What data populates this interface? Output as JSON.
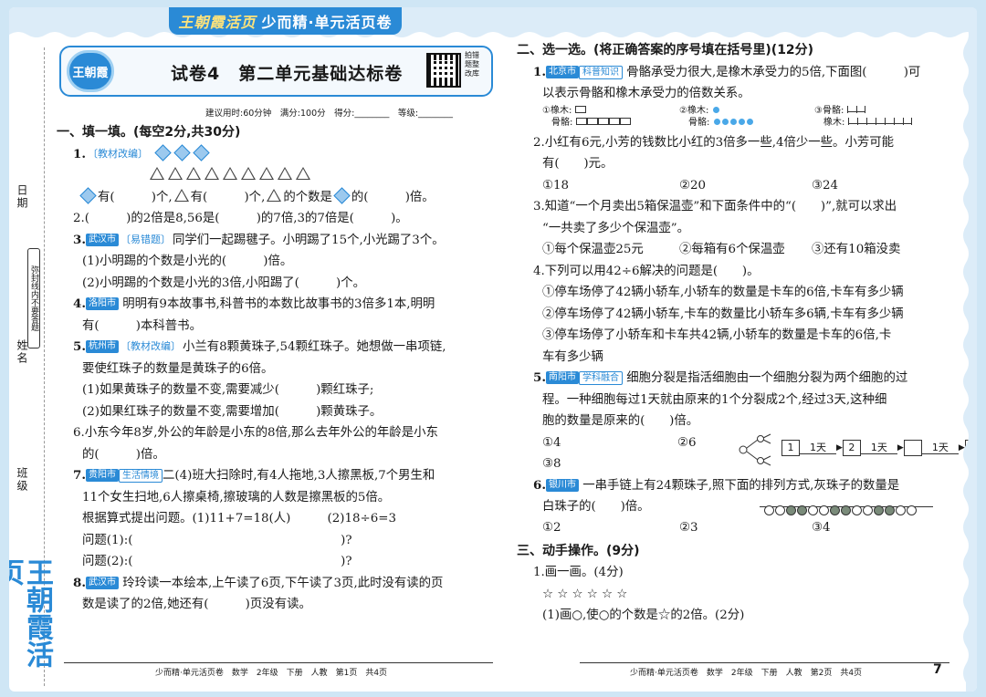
{
  "brand": {
    "logo": "王朝霞活页",
    "bar_text": "少而精·单元活页卷"
  },
  "side": {
    "date": "日期",
    "name": "姓名",
    "class": "班级",
    "seal_note": "弥封线内不要答题",
    "brand_vertical": "王朝霞活页"
  },
  "header": {
    "seal_text": "王朝霞",
    "title": "试卷4　第二单元基础达标卷",
    "qr_text": "拍错题整改库"
  },
  "info_line": "建议用时:60分钟　满分:100分　得分:________　等级:________",
  "left": {
    "s1_title": "一、填一填。(每空2分,共30分)",
    "q1_num": "1.",
    "q1_tag": "〔教材改编〕",
    "q1_line2": "有(　　　)个,",
    "q1_line2b": "有(　　　)个,",
    "q1_line2c": "的个数是",
    "q1_line2d": "的(　　　)倍。",
    "q2": "2.(　　　)的2倍是8,56是(　　　)的7倍,3的7倍是(　　　)。",
    "q3_num": "3.",
    "q3_city": "武汉市",
    "q3_tag": "易错题",
    "q3_text": "同学们一起踢毽子。小明踢了15个,小光踢了3个。",
    "q3_a": "(1)小明踢的个数是小光的(　　　)倍。",
    "q3_b": "(2)小明踢的个数是小光的3倍,小阳踢了(　　　)个。",
    "q4_num": "4.",
    "q4_city": "洛阳市",
    "q4_text": "明明有9本故事书,科普书的本数比故事书的3倍多1本,明明",
    "q4_text2": "有(　　　)本科普书。",
    "q5_num": "5.",
    "q5_city": "杭州市",
    "q5_tag": "〔教材改编〕",
    "q5_text": "小兰有8颗黄珠子,54颗红珠子。她想做一串项链,",
    "q5_text2": "要使红珠子的数量是黄珠子的6倍。",
    "q5_a": "(1)如果黄珠子的数量不变,需要减少(　　　)颗红珠子;",
    "q5_b": "(2)如果红珠子的数量不变,需要增加(　　　)颗黄珠子。",
    "q6": "6.小东今年8岁,外公的年龄是小东的8倍,那么去年外公的年龄是小东",
    "q6_2": "的(　　　)倍。",
    "q7_num": "7.",
    "q7_city": "贵阳市",
    "q7_tag": "生活情境",
    "q7_text": "二(4)班大扫除时,有4人拖地,3人擦黑板,7个男生和",
    "q7_text2": "11个女生扫地,6人擦桌椅,擦玻璃的人数是擦黑板的5倍。",
    "q7_text3": "根据算式提出问题。(1)11+7=18(人)　　　(2)18÷6=3",
    "q7_p1": "问题(1):(　　　　　　　　　　　　　　　　　)?",
    "q7_p2": "问题(2):(　　　　　　　　　　　　　　　　　)?",
    "q8_num": "8.",
    "q8_city": "武汉市",
    "q8_text": "玲玲读一本绘本,上午读了6页,下午读了3页,此时没有读的页",
    "q8_text2": "数是读了的2倍,她还有(　　　)页没有读。",
    "footer": "少而精·单元活页卷　数学　2年级　下册　人教　第1页　共4页"
  },
  "right": {
    "s2_title": "二、选一选。(将正确答案的序号填在括号里)(12分)",
    "q1_num": "1.",
    "q1_city": "北京市",
    "q1_tag": "科普知识",
    "q1_text": "骨骼承受力很大,是橡木承受力的5倍,下面图(　　　)可",
    "q1_text2": "以表示骨骼和橡木承受力的倍数关系。",
    "q1_opt1a": "①橡木:",
    "q1_opt1b": "骨骼:",
    "q1_opt2a": "②橡木:",
    "q1_opt2b": "骨骼:",
    "q1_opt3a": "③骨骼:",
    "q1_opt3b": "橡木:",
    "q2": "2.小红有6元,小芳的钱数比小红的3倍多一些,4倍少一些。小芳可能",
    "q2_2": "有(　　)元。",
    "q2_o1": "①18",
    "q2_o2": "②20",
    "q2_o3": "③24",
    "q3": "3.知道“一个月卖出5箱保温壶”和下面条件中的“(　　)”,就可以求出",
    "q3_2": "“一共卖了多少个保温壶”。",
    "q3_o1": "①每个保温壶25元",
    "q3_o2": "②每箱有6个保温壶",
    "q3_o3": "③还有10箱没卖",
    "q4": "4.下列可以用42÷6解决的问题是(　　)。",
    "q4_o1": "①停车场停了42辆小轿车,小轿车的数量是卡车的6倍,卡车有多少辆",
    "q4_o2": "②停车场停了42辆小轿车,卡车的数量比小轿车多6辆,卡车有多少辆",
    "q4_o3": "③停车场停了小轿车和卡车共42辆,小轿车的数量是卡车的6倍,卡",
    "q4_o3b": "车有多少辆",
    "q5_num": "5.",
    "q5_city": "南阳市",
    "q5_tag": "学科融合",
    "q5_text": "细胞分裂是指活细胞由一个细胞分裂为两个细胞的过",
    "q5_text2": "程。一种细胞每过1天就由原来的1个分裂成2个,经过3天,这种细",
    "q5_text3": "胞的数量是原来的(　　)倍。",
    "q5_o1": "①4",
    "q5_o2": "②6",
    "q5_o3": "③8",
    "q5_d1": "1",
    "q5_d2": "2",
    "q5_day": "1天",
    "q6_num": "6.",
    "q6_city": "银川市",
    "q6_text": "一串手链上有24颗珠子,照下面的排列方式,灰珠子的数量是",
    "q6_text2": "白珠子的(　　)倍。",
    "q6_o1": "①2",
    "q6_o2": "②3",
    "q6_o3": "③4",
    "s3_title": "三、动手操作。(9分)",
    "s3_q1": "1.画一画。(4分)",
    "s3_stars": "☆ ☆ ☆ ☆ ☆ ☆",
    "s3_sub": "(1)画○,使○的个数是☆的2倍。(2分)",
    "footer": "少而精·单元活页卷　数学　2年级　下册　人教　第2页　共4页",
    "page_number": "7"
  }
}
